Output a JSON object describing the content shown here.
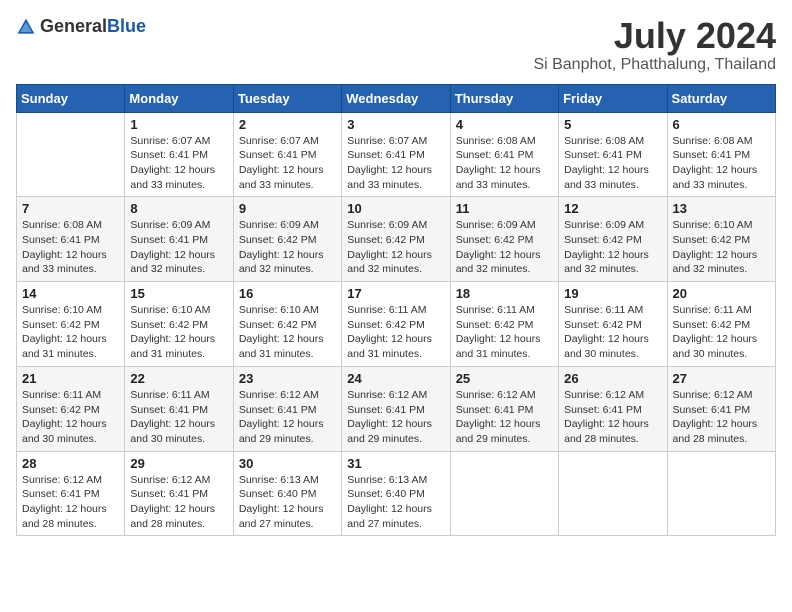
{
  "logo": {
    "text_general": "General",
    "text_blue": "Blue"
  },
  "title": "July 2024",
  "location": "Si Banphot, Phatthalung, Thailand",
  "weekdays": [
    "Sunday",
    "Monday",
    "Tuesday",
    "Wednesday",
    "Thursday",
    "Friday",
    "Saturday"
  ],
  "weeks": [
    [
      {
        "day": "",
        "info": ""
      },
      {
        "day": "1",
        "info": "Sunrise: 6:07 AM\nSunset: 6:41 PM\nDaylight: 12 hours\nand 33 minutes."
      },
      {
        "day": "2",
        "info": "Sunrise: 6:07 AM\nSunset: 6:41 PM\nDaylight: 12 hours\nand 33 minutes."
      },
      {
        "day": "3",
        "info": "Sunrise: 6:07 AM\nSunset: 6:41 PM\nDaylight: 12 hours\nand 33 minutes."
      },
      {
        "day": "4",
        "info": "Sunrise: 6:08 AM\nSunset: 6:41 PM\nDaylight: 12 hours\nand 33 minutes."
      },
      {
        "day": "5",
        "info": "Sunrise: 6:08 AM\nSunset: 6:41 PM\nDaylight: 12 hours\nand 33 minutes."
      },
      {
        "day": "6",
        "info": "Sunrise: 6:08 AM\nSunset: 6:41 PM\nDaylight: 12 hours\nand 33 minutes."
      }
    ],
    [
      {
        "day": "7",
        "info": "Sunrise: 6:08 AM\nSunset: 6:41 PM\nDaylight: 12 hours\nand 33 minutes."
      },
      {
        "day": "8",
        "info": "Sunrise: 6:09 AM\nSunset: 6:41 PM\nDaylight: 12 hours\nand 32 minutes."
      },
      {
        "day": "9",
        "info": "Sunrise: 6:09 AM\nSunset: 6:42 PM\nDaylight: 12 hours\nand 32 minutes."
      },
      {
        "day": "10",
        "info": "Sunrise: 6:09 AM\nSunset: 6:42 PM\nDaylight: 12 hours\nand 32 minutes."
      },
      {
        "day": "11",
        "info": "Sunrise: 6:09 AM\nSunset: 6:42 PM\nDaylight: 12 hours\nand 32 minutes."
      },
      {
        "day": "12",
        "info": "Sunrise: 6:09 AM\nSunset: 6:42 PM\nDaylight: 12 hours\nand 32 minutes."
      },
      {
        "day": "13",
        "info": "Sunrise: 6:10 AM\nSunset: 6:42 PM\nDaylight: 12 hours\nand 32 minutes."
      }
    ],
    [
      {
        "day": "14",
        "info": "Sunrise: 6:10 AM\nSunset: 6:42 PM\nDaylight: 12 hours\nand 31 minutes."
      },
      {
        "day": "15",
        "info": "Sunrise: 6:10 AM\nSunset: 6:42 PM\nDaylight: 12 hours\nand 31 minutes."
      },
      {
        "day": "16",
        "info": "Sunrise: 6:10 AM\nSunset: 6:42 PM\nDaylight: 12 hours\nand 31 minutes."
      },
      {
        "day": "17",
        "info": "Sunrise: 6:11 AM\nSunset: 6:42 PM\nDaylight: 12 hours\nand 31 minutes."
      },
      {
        "day": "18",
        "info": "Sunrise: 6:11 AM\nSunset: 6:42 PM\nDaylight: 12 hours\nand 31 minutes."
      },
      {
        "day": "19",
        "info": "Sunrise: 6:11 AM\nSunset: 6:42 PM\nDaylight: 12 hours\nand 30 minutes."
      },
      {
        "day": "20",
        "info": "Sunrise: 6:11 AM\nSunset: 6:42 PM\nDaylight: 12 hours\nand 30 minutes."
      }
    ],
    [
      {
        "day": "21",
        "info": "Sunrise: 6:11 AM\nSunset: 6:42 PM\nDaylight: 12 hours\nand 30 minutes."
      },
      {
        "day": "22",
        "info": "Sunrise: 6:11 AM\nSunset: 6:41 PM\nDaylight: 12 hours\nand 30 minutes."
      },
      {
        "day": "23",
        "info": "Sunrise: 6:12 AM\nSunset: 6:41 PM\nDaylight: 12 hours\nand 29 minutes."
      },
      {
        "day": "24",
        "info": "Sunrise: 6:12 AM\nSunset: 6:41 PM\nDaylight: 12 hours\nand 29 minutes."
      },
      {
        "day": "25",
        "info": "Sunrise: 6:12 AM\nSunset: 6:41 PM\nDaylight: 12 hours\nand 29 minutes."
      },
      {
        "day": "26",
        "info": "Sunrise: 6:12 AM\nSunset: 6:41 PM\nDaylight: 12 hours\nand 28 minutes."
      },
      {
        "day": "27",
        "info": "Sunrise: 6:12 AM\nSunset: 6:41 PM\nDaylight: 12 hours\nand 28 minutes."
      }
    ],
    [
      {
        "day": "28",
        "info": "Sunrise: 6:12 AM\nSunset: 6:41 PM\nDaylight: 12 hours\nand 28 minutes."
      },
      {
        "day": "29",
        "info": "Sunrise: 6:12 AM\nSunset: 6:41 PM\nDaylight: 12 hours\nand 28 minutes."
      },
      {
        "day": "30",
        "info": "Sunrise: 6:13 AM\nSunset: 6:40 PM\nDaylight: 12 hours\nand 27 minutes."
      },
      {
        "day": "31",
        "info": "Sunrise: 6:13 AM\nSunset: 6:40 PM\nDaylight: 12 hours\nand 27 minutes."
      },
      {
        "day": "",
        "info": ""
      },
      {
        "day": "",
        "info": ""
      },
      {
        "day": "",
        "info": ""
      }
    ]
  ]
}
